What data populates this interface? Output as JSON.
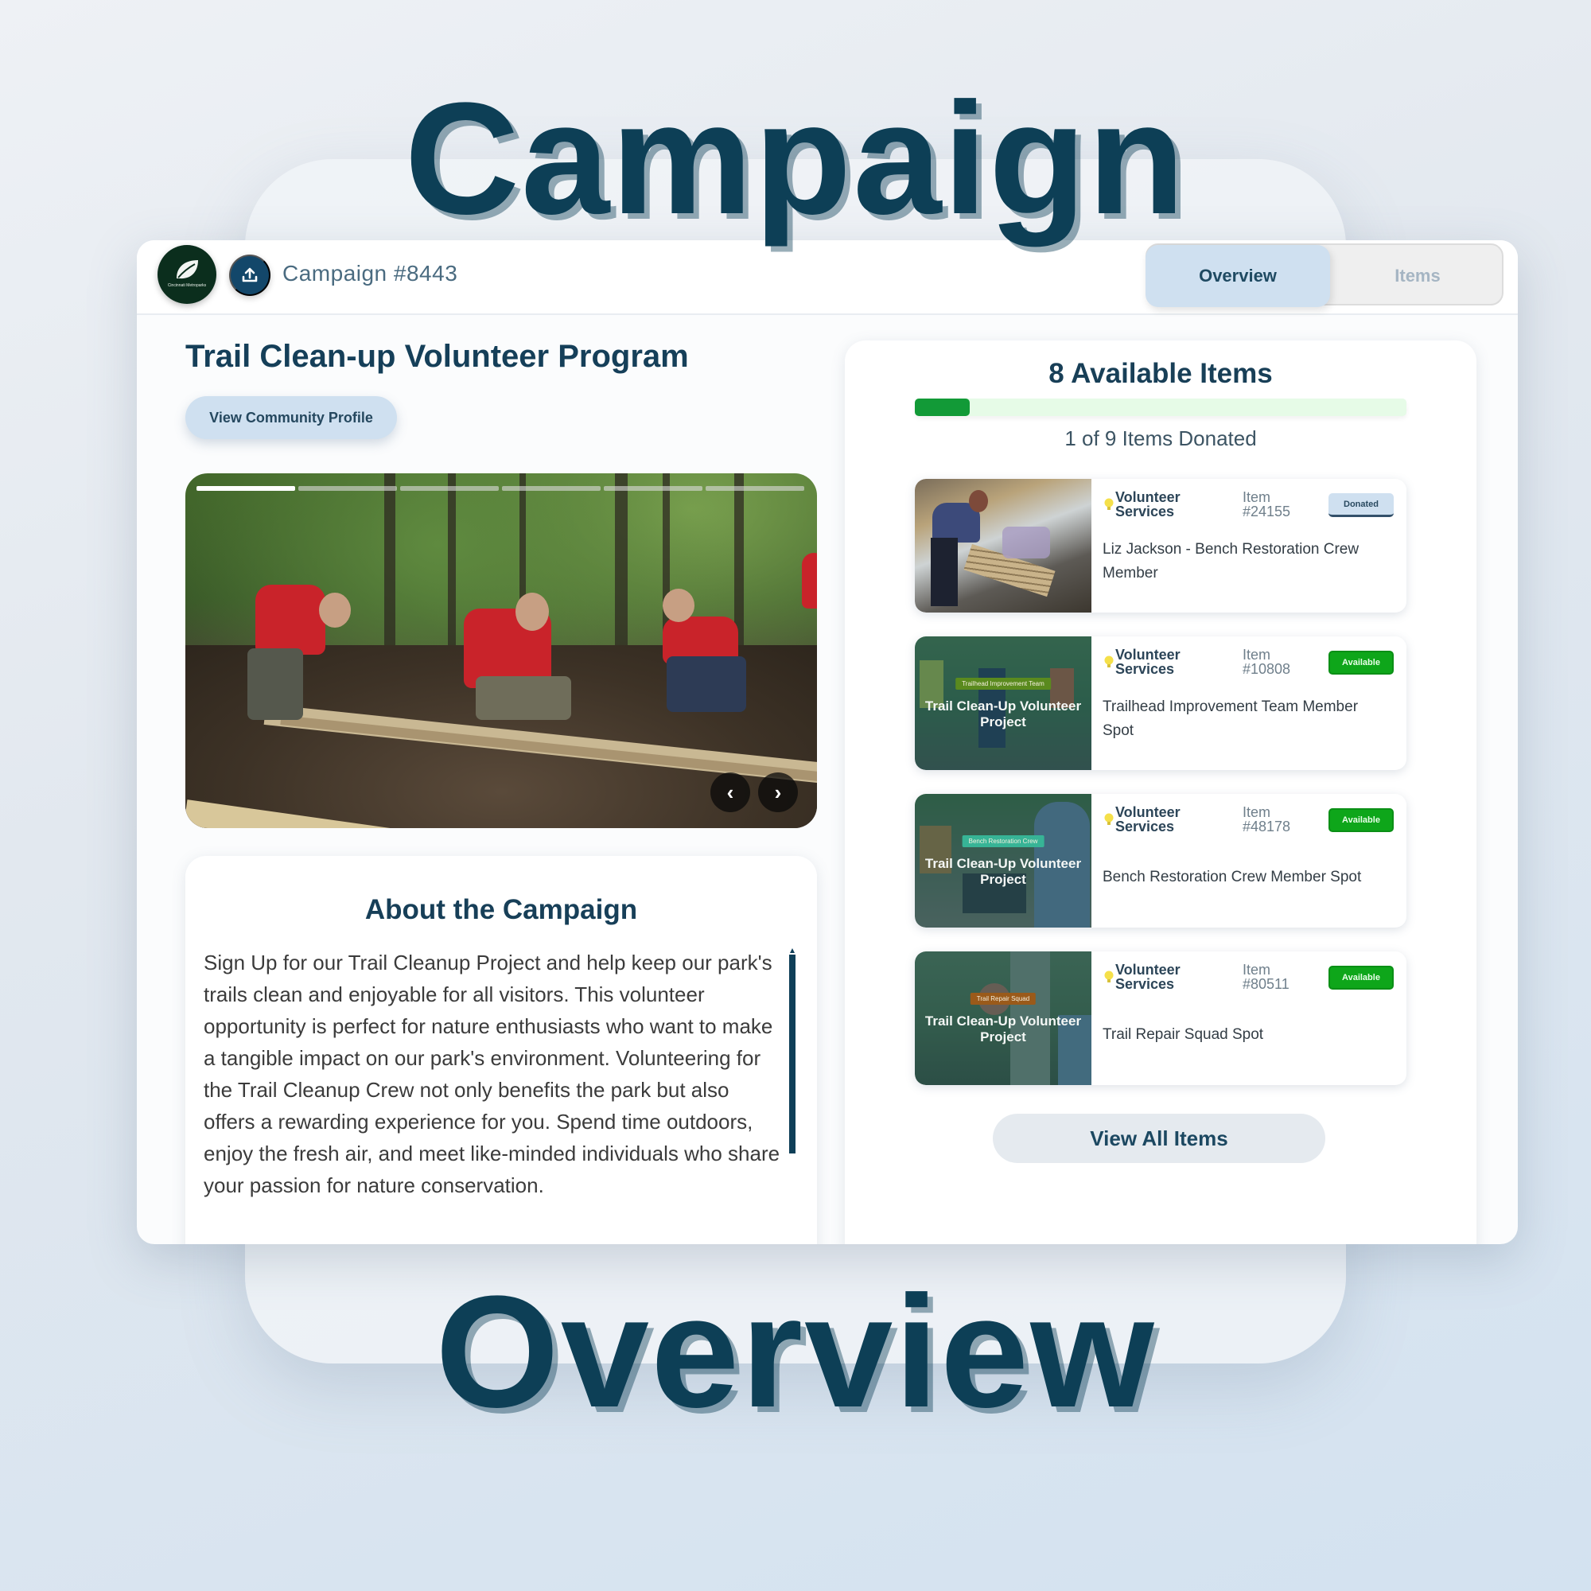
{
  "hero": {
    "top_word": "Campaign",
    "bottom_word": "Overview"
  },
  "header": {
    "logo_text": "Cincinnati Metroparks",
    "campaign_id": "Campaign #8443",
    "tabs": [
      {
        "label": "Overview",
        "active": true
      },
      {
        "label": "Items",
        "active": false
      }
    ]
  },
  "program": {
    "title": "Trail Clean-up Volunteer Program",
    "community_button": "View Community Profile"
  },
  "carousel": {
    "slide_count": 6,
    "active_slide": 1,
    "prev_icon": "‹",
    "next_icon": "›"
  },
  "about": {
    "title": "About the Campaign",
    "text": "Sign Up for our Trail Cleanup Project and help keep our park's trails clean and enjoyable for all visitors. This volunteer opportunity is perfect for nature enthusiasts who want to make a tangible impact on our park's environment. Volunteering for the Trail Cleanup Crew not only benefits the park but also offers a rewarding experience for you. Spend time outdoors, enjoy the fresh air, and meet like-minded individuals who share your passion for nature conservation."
  },
  "items_panel": {
    "title": "8 Available Items",
    "donated_count": 1,
    "total_count": 9,
    "donated_text": "1 of 9 Items Donated",
    "view_all_label": "View All Items",
    "items": [
      {
        "category_line1": "Volunteer",
        "category_line2": "Services",
        "item_label": "Item",
        "item_number": "#24155",
        "status": "Donated",
        "name": "Liz Jackson - Bench Restoration Crew Member",
        "thumb_tag": "",
        "thumb_title": ""
      },
      {
        "category_line1": "Volunteer",
        "category_line2": "Services",
        "item_label": "Item",
        "item_number": "#10808",
        "status": "Available",
        "name": "Trailhead Improvement Team Member Spot",
        "thumb_tag": "Trailhead Improvement Team",
        "thumb_title": "Trail Clean-Up Volunteer Project",
        "tag_color": "#5a8a1e"
      },
      {
        "category_line1": "Volunteer",
        "category_line2": "Services",
        "item_label": "Item",
        "item_number": "#48178",
        "status": "Available",
        "name": "Bench Restoration Crew Member Spot",
        "thumb_tag": "Bench Restoration Crew",
        "thumb_title": "Trail Clean-Up Volunteer Project",
        "tag_color": "#37b496"
      },
      {
        "category_line1": "Volunteer",
        "category_line2": "Services",
        "item_label": "Item",
        "item_number": "#80511",
        "status": "Available",
        "name": "Trail Repair Squad Spot",
        "thumb_tag": "Trail Repair Squad",
        "thumb_title": "Trail Clean-Up Volunteer Project",
        "tag_color": "#9a5a1a"
      }
    ]
  },
  "colors": {
    "brand_dark": "#0d3f56",
    "tab_active_bg": "#cfe0f0",
    "progress_fill": "#129a37",
    "progress_track": "#e6fbe7",
    "available": "#0ea61a"
  }
}
